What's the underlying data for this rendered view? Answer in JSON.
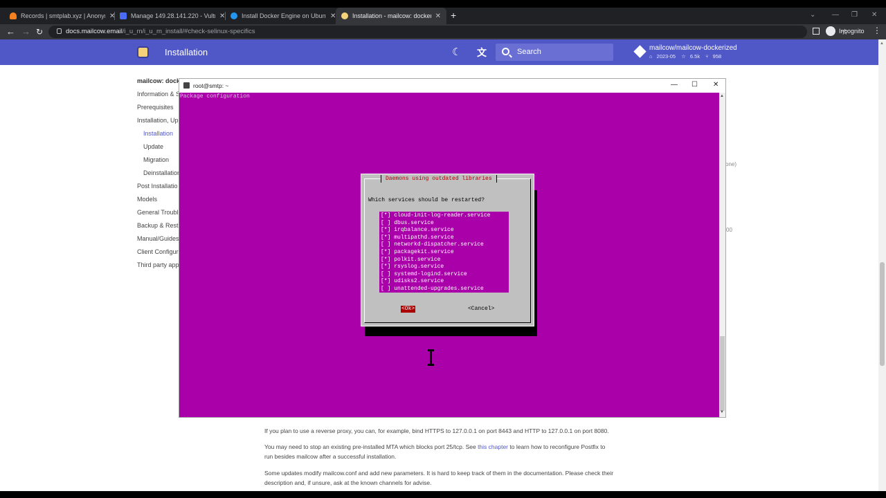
{
  "browser": {
    "tabs": [
      {
        "title": "Records | smtplab.xyz | Anonym",
        "favicon_color": "#f48120"
      },
      {
        "title": "Manage 149.28.141.220 - Vultr.c",
        "favicon_color": "#4a6cf7"
      },
      {
        "title": "Install Docker Engine on Ubuntu",
        "favicon_color": "#2496ed"
      },
      {
        "title": "Installation - mailcow: dockerize",
        "favicon_color": "#f4d27a"
      }
    ],
    "url_host": "docs.mailcow.email",
    "url_path": "/i_u_m/i_u_m_install/#check-selinux-specifics",
    "profile_label": "Incognito"
  },
  "site": {
    "title": "Installation",
    "search_placeholder": "Search",
    "repo": {
      "name": "mailcow/mailcow-dockerized",
      "release": "2023-05",
      "stars": "6.5k",
      "forks": "958"
    }
  },
  "sidebar": {
    "items": [
      {
        "label": "mailcow: dock",
        "level": "group"
      },
      {
        "label": "Information & S",
        "level": "top"
      },
      {
        "label": "Prerequisites",
        "level": "top"
      },
      {
        "label": "Installation, Up",
        "level": "top"
      },
      {
        "label": "Installation",
        "level": "sub",
        "active": true
      },
      {
        "label": "Update",
        "level": "sub"
      },
      {
        "label": "Migration",
        "level": "sub"
      },
      {
        "label": "Deinstallation",
        "level": "sub"
      },
      {
        "label": "Post Installatio",
        "level": "top"
      },
      {
        "label": "Models",
        "level": "top"
      },
      {
        "label": "General Trouble",
        "level": "top"
      },
      {
        "label": "Backup & Resto",
        "level": "top"
      },
      {
        "label": "Manual/Guides",
        "level": "top"
      },
      {
        "label": "Client Configur",
        "level": "top"
      },
      {
        "label": "Third party app",
        "level": "top"
      }
    ]
  },
  "content": {
    "edge_fragment_1": "one)",
    "edge_fragment_2": "00",
    "para_proxy": "If you plan to use a reverse proxy, you can, for example, bind HTTPS to 127.0.0.1 on port 8443 and HTTP to 127.0.0.1 on port 8080.",
    "para_mta_before": "You may need to stop an existing pre-installed MTA which blocks port 25/tcp. See ",
    "para_mta_link": "this chapter",
    "para_mta_after": " to learn how to reconfigure Postfix to run besides mailcow after a successful installation.",
    "para_updates": "Some updates modify mailcow.conf and add new parameters. It is hard to keep track of them in the documentation. Please check their description and, if unsure, ask at the known channels for advise."
  },
  "terminal": {
    "window_title": "root@smtp: ~",
    "screen_header": "Package configuration",
    "colors": {
      "background": "#aa00aa",
      "dialog": "#c0c0c0",
      "title": "#aa0000"
    },
    "dialog": {
      "title": "Daemons using outdated libraries",
      "question": "Which services should be restarted?",
      "services": [
        {
          "mark": "[*]",
          "name": "cloud-init-log-reader.service"
        },
        {
          "mark": "[ ]",
          "name": "dbus.service"
        },
        {
          "mark": "[*]",
          "name": "irqbalance.service"
        },
        {
          "mark": "[*]",
          "name": "multipathd.service"
        },
        {
          "mark": "[ ]",
          "name": "networkd-dispatcher.service"
        },
        {
          "mark": "[*]",
          "name": "packagekit.service"
        },
        {
          "mark": "[*]",
          "name": "polkit.service"
        },
        {
          "mark": "[*]",
          "name": "rsyslog.service"
        },
        {
          "mark": "[ ]",
          "name": "systemd-logind.service"
        },
        {
          "mark": "[*]",
          "name": "udisks2.service"
        },
        {
          "mark": "[ ]",
          "name": "unattended-upgrades.service"
        }
      ],
      "ok_label": "<Ok>",
      "cancel_label": "<Cancel>"
    }
  }
}
